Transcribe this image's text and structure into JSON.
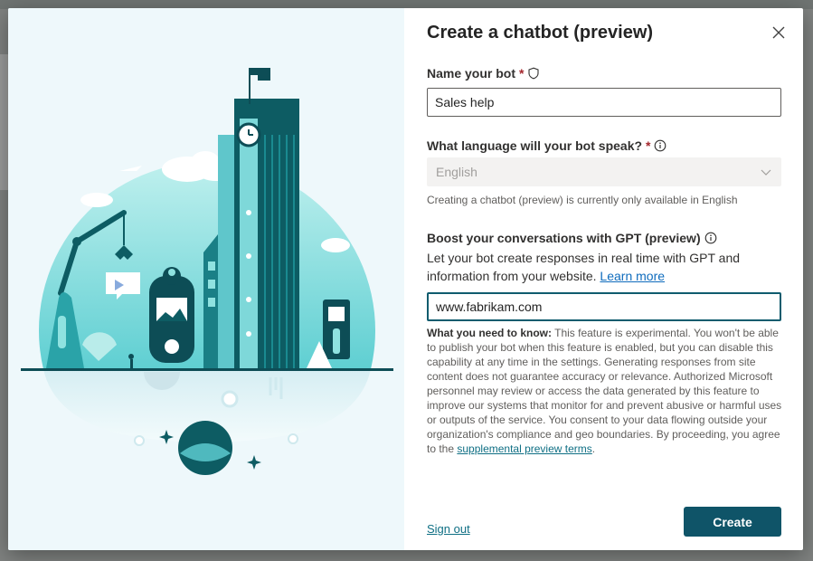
{
  "dialog": {
    "title": "Create a chatbot (preview)",
    "close_label": "×"
  },
  "name_field": {
    "label": "Name your bot",
    "required_mark": "*",
    "value": "Sales help"
  },
  "language_field": {
    "label": "What language will your bot speak?",
    "required_mark": "*",
    "value": "English",
    "helper": "Creating a chatbot (preview) is currently only available in English"
  },
  "gpt_section": {
    "label": "Boost your conversations with GPT (preview)",
    "description": "Let your bot create responses in real time with GPT and information from your website.",
    "learn_more": "Learn more",
    "website_value": "www.fabrikam.com"
  },
  "notice": {
    "heading": "What you need to know:",
    "body": "This feature is experimental. You won't be able to publish your bot when this feature is enabled, but you can disable this capability at any time in the settings. Generating responses from site content does not guarantee accuracy or relevance. Authorized Microsoft personnel may review or access the data generated by this feature to improve our systems that monitor for and prevent abusive or harmful uses or outputs of the service. You consent to your data flowing outside your organization's compliance and geo boundaries. By proceeding, you agree to the",
    "terms_link": "supplemental preview terms",
    "end": "."
  },
  "footer": {
    "sign_out": "Sign out",
    "create": "Create"
  },
  "colors": {
    "accent": "#0f5468",
    "illustration_teal": "#6fd3d6",
    "illustration_dark": "#0d5c63"
  }
}
